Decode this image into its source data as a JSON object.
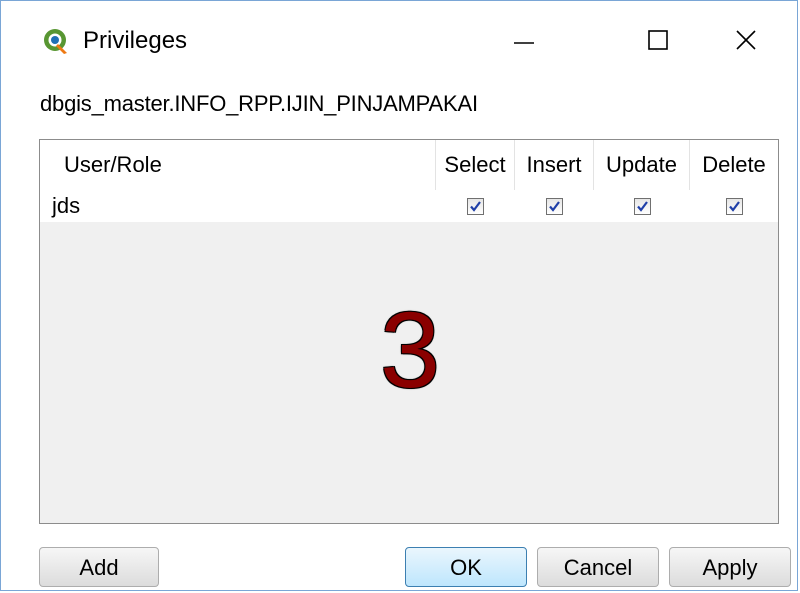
{
  "window": {
    "title": "Privileges",
    "icon": "qgis-icon",
    "controls": {
      "minimize_icon": "minimize-icon",
      "maximize_icon": "maximize-icon",
      "close_icon": "close-icon"
    }
  },
  "path_label": "dbgis_master.INFO_RPP.IJIN_PINJAMPAKAI",
  "table": {
    "headers": {
      "user": "User/Role",
      "select": "Select",
      "insert": "Insert",
      "update": "Update",
      "delete": "Delete"
    },
    "rows": [
      {
        "user": "jds",
        "select": true,
        "insert": true,
        "update": true,
        "delete": true
      }
    ]
  },
  "annotation": "3",
  "buttons": {
    "add": "Add",
    "ok": "OK",
    "cancel": "Cancel",
    "apply": "Apply"
  },
  "colors": {
    "annotation": "#8a0000",
    "check": "#1f3fa8"
  }
}
